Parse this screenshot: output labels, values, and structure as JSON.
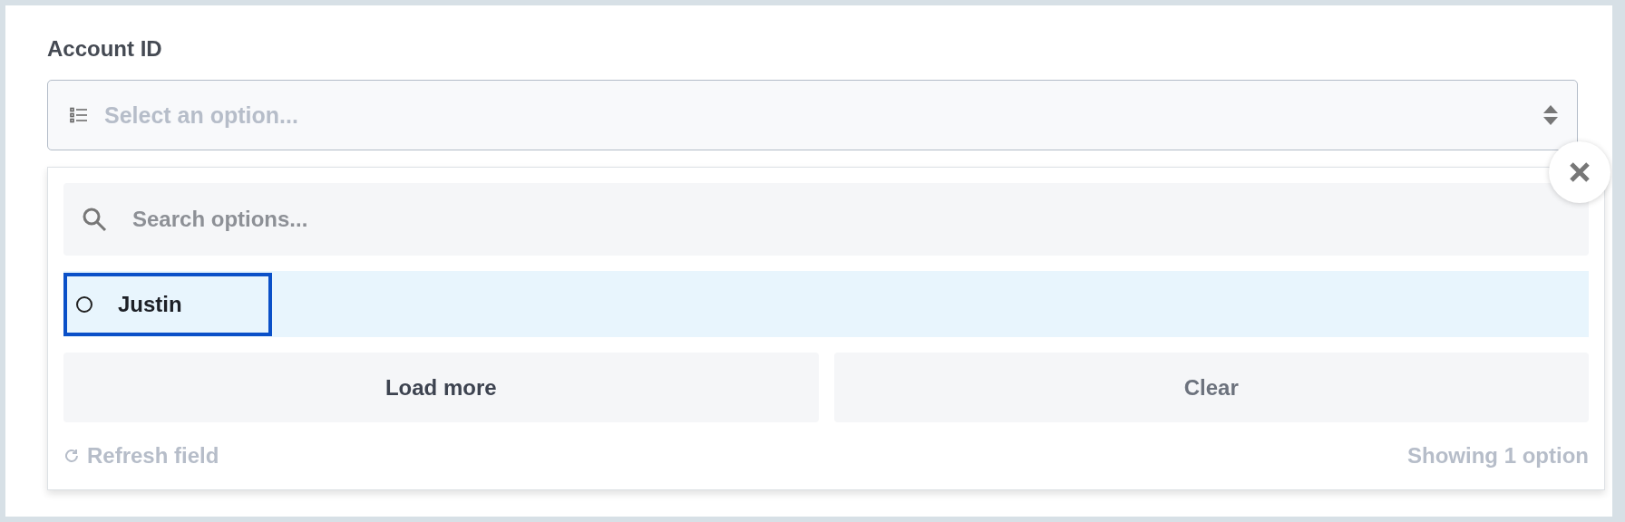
{
  "field": {
    "label": "Account ID",
    "placeholder": "Select an option..."
  },
  "dropdown": {
    "search": {
      "placeholder": "Search options..."
    },
    "options": [
      {
        "label": "Justin",
        "selected": false,
        "focused": true
      }
    ],
    "buttons": [
      "Load more",
      "Clear"
    ],
    "refresh": "Refresh field",
    "count": "Showing 1 option"
  }
}
